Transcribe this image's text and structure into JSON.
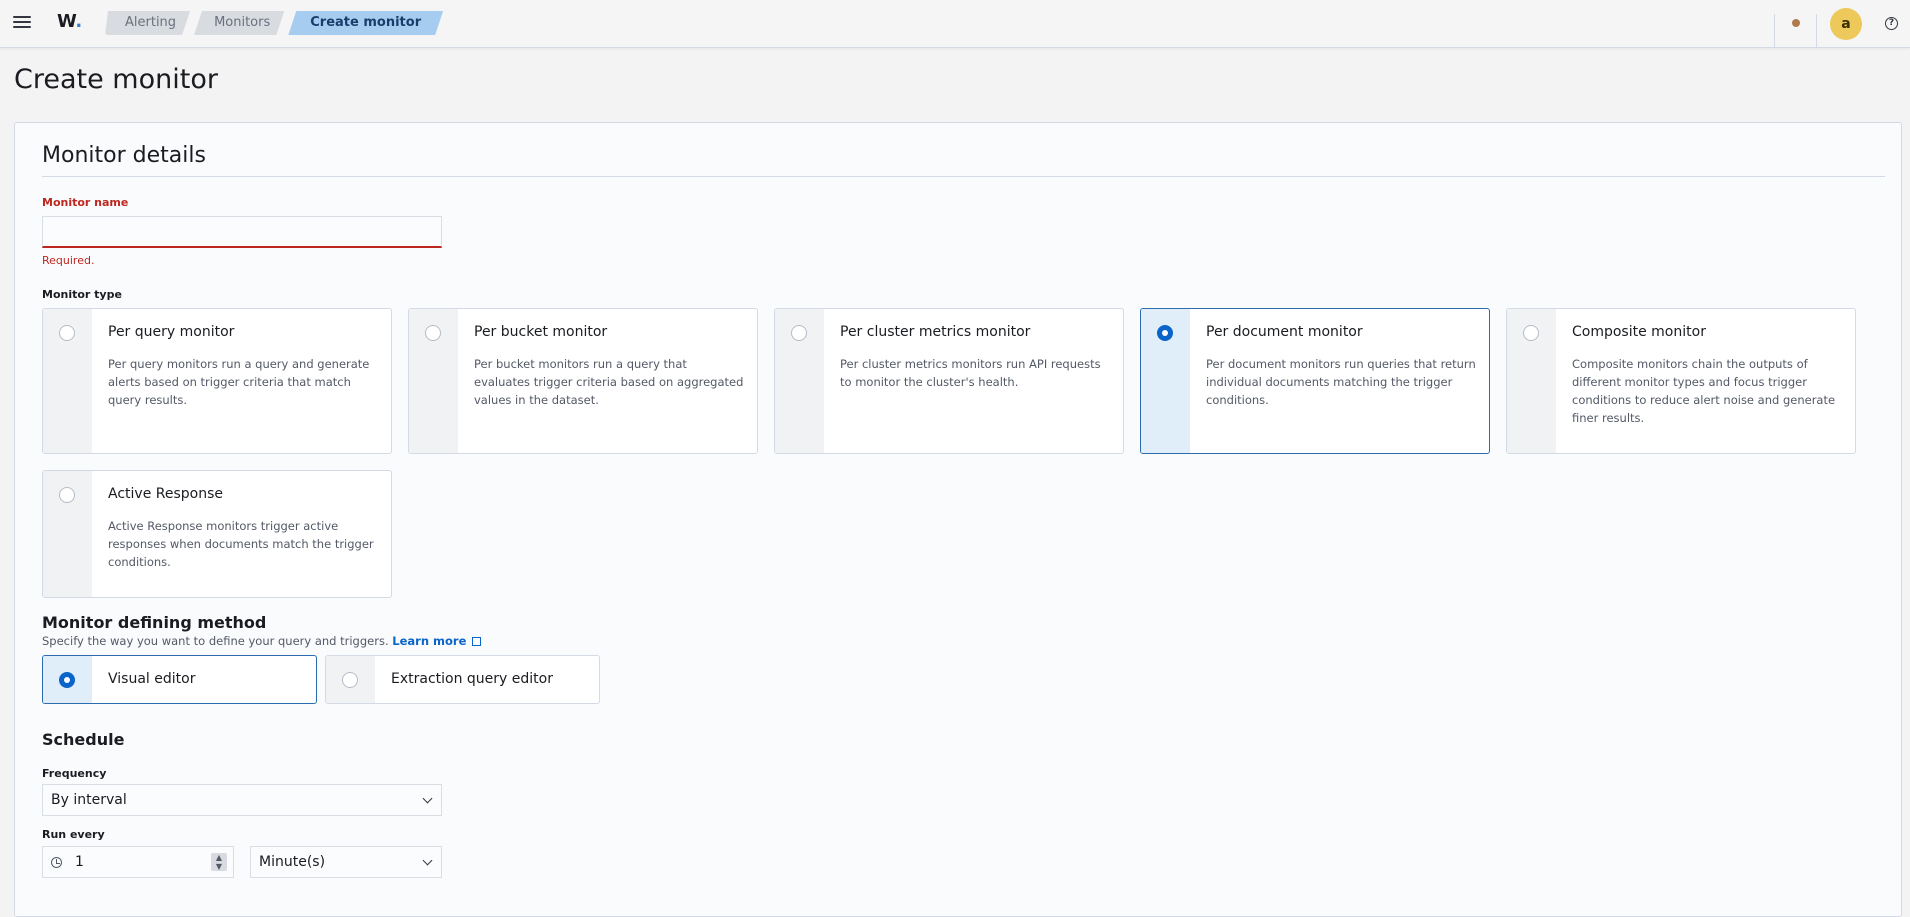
{
  "header": {
    "logo": "W",
    "logo_dot": ".",
    "breadcrumbs": [
      "Alerting",
      "Monitors",
      "Create monitor"
    ],
    "avatar_initial": "a",
    "help_glyph": "?"
  },
  "page": {
    "title": "Create monitor"
  },
  "details": {
    "title": "Monitor details",
    "name_label": "Monitor name",
    "name_value": "",
    "name_error": "Required.",
    "type_label": "Monitor type",
    "types": [
      {
        "title": "Per query monitor",
        "description": "Per query monitors run a query and generate alerts based on trigger criteria that match query results.",
        "selected": false
      },
      {
        "title": "Per bucket monitor",
        "description": "Per bucket monitors run a query that evaluates trigger criteria based on aggregated values in the dataset.",
        "selected": false
      },
      {
        "title": "Per cluster metrics monitor",
        "description": "Per cluster metrics monitors run API requests to monitor the cluster's health.",
        "selected": false
      },
      {
        "title": "Per document monitor",
        "description": "Per document monitors run queries that return individual documents matching the trigger conditions.",
        "selected": true
      },
      {
        "title": "Composite monitor",
        "description": "Composite monitors chain the outputs of different monitor types and focus trigger conditions to reduce alert noise and generate finer results.",
        "selected": false
      },
      {
        "title": "Active Response",
        "description": "Active Response monitors trigger active responses when documents match the trigger conditions.",
        "selected": false
      }
    ]
  },
  "method": {
    "title": "Monitor defining method",
    "subtitle": "Specify the way you want to define your query and triggers.",
    "learn_more": "Learn more",
    "options": [
      {
        "label": "Visual editor",
        "selected": true
      },
      {
        "label": "Extraction query editor",
        "selected": false
      }
    ]
  },
  "schedule": {
    "title": "Schedule",
    "frequency_label": "Frequency",
    "frequency_value": "By interval",
    "run_every_label": "Run every",
    "run_every_value": "1",
    "unit_value": "Minute(s)"
  },
  "colors": {
    "accent": "#0b64c9",
    "error": "#bd271e",
    "breadcrumb_active": "#a6cdf0",
    "avatar": "#ecc95a"
  }
}
